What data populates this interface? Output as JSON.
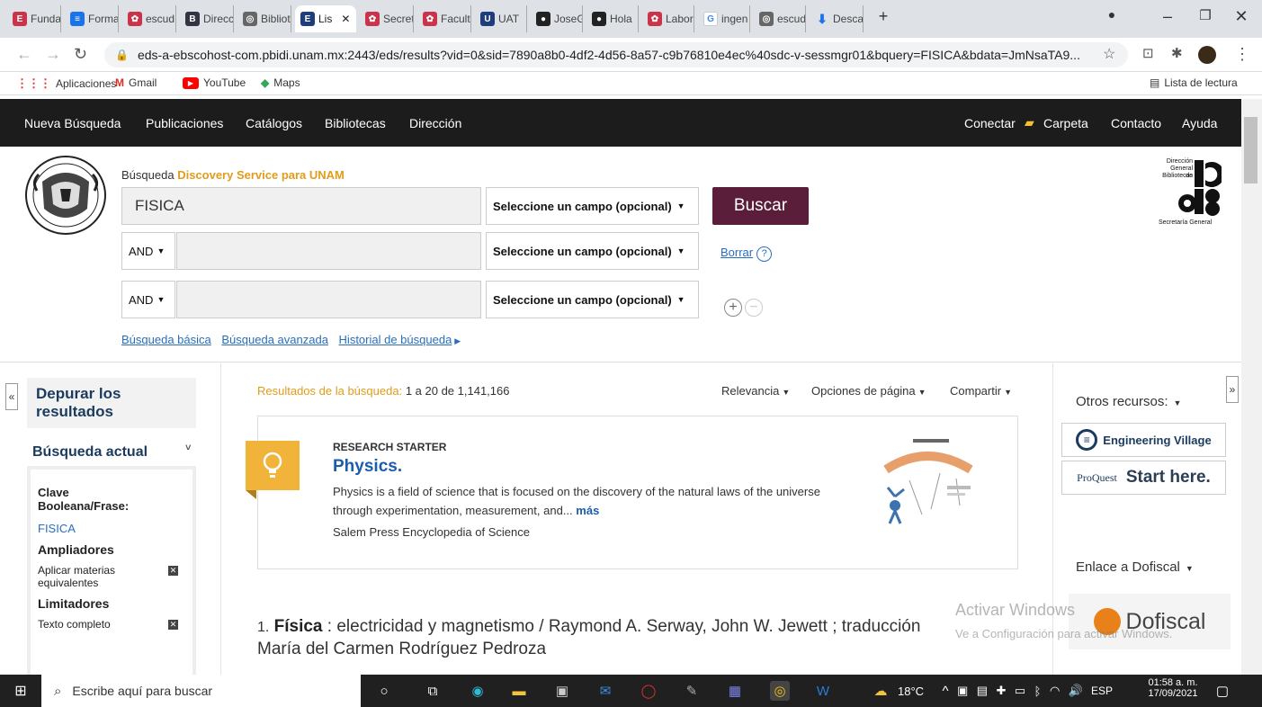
{
  "browser": {
    "tabs": [
      {
        "label": "Funda",
        "icon": "E",
        "color": "fv-red"
      },
      {
        "label": "Forma",
        "icon": "≡",
        "color": "fv-blue"
      },
      {
        "label": "escud",
        "icon": "✿",
        "color": "fv-red"
      },
      {
        "label": "Direcc",
        "icon": "B",
        "color": "fv-dark"
      },
      {
        "label": "Bibliot",
        "icon": "◎",
        "color": "fv-gray"
      },
      {
        "label": "Lis",
        "icon": "E",
        "color": "fv-navy",
        "active": true
      },
      {
        "label": "Secret",
        "icon": "✿",
        "color": "fv-red"
      },
      {
        "label": "Facult",
        "icon": "✿",
        "color": "fv-red"
      },
      {
        "label": "UAT",
        "icon": "U",
        "color": "fv-navy"
      },
      {
        "label": "JoseG",
        "icon": "●",
        "color": "fv-black"
      },
      {
        "label": "Hola",
        "icon": "●",
        "color": "fv-black"
      },
      {
        "label": "Labor",
        "icon": "✿",
        "color": "fv-red"
      },
      {
        "label": "ingen",
        "icon": "G",
        "color": "fv-g"
      },
      {
        "label": "escud",
        "icon": "◎",
        "color": "fv-gray"
      },
      {
        "label": "Desca",
        "icon": "⬇",
        "color": "fv-dl"
      }
    ],
    "new_tab": "+",
    "url": "eds-a-ebscohost-com.pbidi.unam.mx:2443/eds/results?vid=0&sid=7890a8b0-4df2-4d56-8a57-c9b76810e4ec%40sdc-v-sessmgr01&bquery=FISICA&bdata=JmNsaTA9...",
    "bookmarks": [
      "Aplicaciones",
      "Gmail",
      "YouTube",
      "Maps"
    ],
    "reading_list": "Lista de lectura"
  },
  "nav": {
    "left": [
      "Nueva Búsqueda",
      "Publicaciones",
      "Catálogos",
      "Bibliotecas",
      "Dirección"
    ],
    "conectar": "Conectar",
    "carpeta": "Carpeta",
    "contacto": "Contacto",
    "ayuda": "Ayuda"
  },
  "search": {
    "label_prefix": "Búsqueda",
    "label_highlight": "Discovery Service para UNAM",
    "query": "FISICA",
    "field_select": "Seleccione un campo (opcional)",
    "bool_op": "AND",
    "buscar": "Buscar",
    "borrar": "Borrar",
    "help": "?",
    "links": [
      "Búsqueda básica",
      "Búsqueda avanzada",
      "Historial de búsqueda"
    ]
  },
  "logo_dgb": {
    "line1": "Dirección",
    "line2": "General de",
    "line3": "Bibliotecas",
    "footer": "Secretaría General"
  },
  "refine": {
    "title": "Depurar los resultados",
    "current": "Búsqueda actual",
    "boolean_label": "Clave Booleana/Frase:",
    "boolean_value": "FISICA",
    "ampliadores": "Ampliadores",
    "aplicar": "Aplicar materias equivalentes",
    "limitadores": "Limitadores",
    "texto_completo": "Texto completo"
  },
  "results": {
    "label": "Resultados de la búsqueda:",
    "range": "1 a 20 de 1,141,166",
    "relevancia": "Relevancia",
    "opciones": "Opciones de página",
    "compartir": "Compartir",
    "starter_label": "RESEARCH STARTER",
    "starter_title": "Physics.",
    "starter_text": "Physics is a field of science that is focused on the discovery of the natural laws of the universe through experimentation, measurement, and...",
    "starter_more": "más",
    "starter_source": "Salem Press Encyclopedia of Science",
    "result1_num": "1.",
    "result1_title": "Física",
    "result1_rest": ": electricidad y magnetismo / Raymond A. Serway, John W. Jewett ; traducción María del Carmen Rodríguez Pedroza"
  },
  "right": {
    "otros": "Otros recursos:",
    "engineering_village": "Engineering Village",
    "proquest_brand": "ProQuest",
    "start_here": "Start here.",
    "enlace": "Enlace a Dofiscal",
    "dofiscal": "Dofiscal"
  },
  "watermark": {
    "line1": "Activar Windows",
    "line2": "Ve a Configuración para activar Windows."
  },
  "taskbar": {
    "search_placeholder": "Escribe aquí para buscar",
    "weather": "18°C",
    "lang": "ESP",
    "time": "01:58 a. m.",
    "date": "17/09/2021"
  }
}
